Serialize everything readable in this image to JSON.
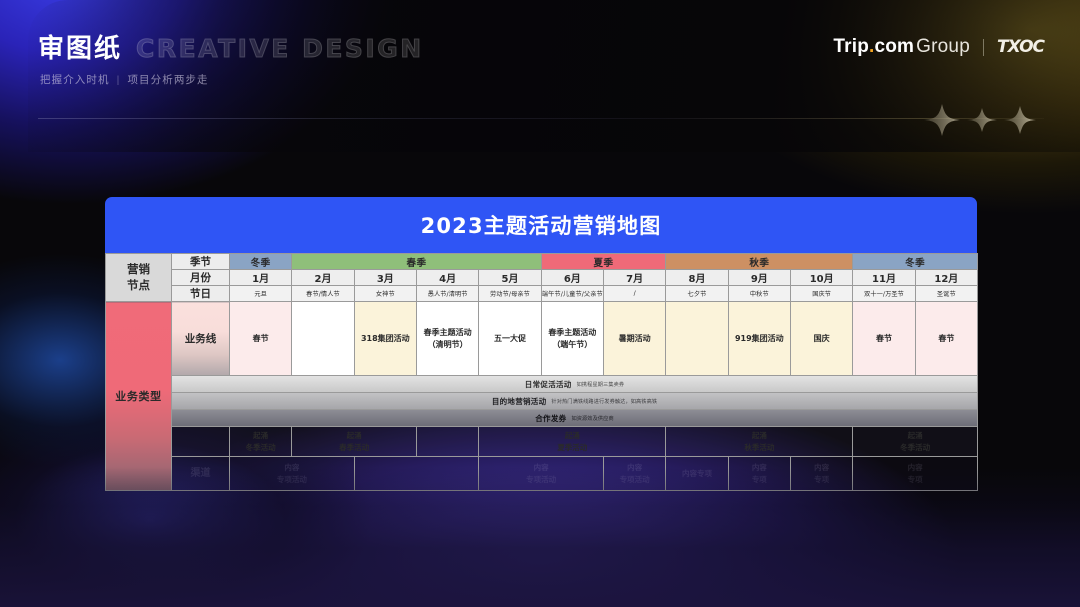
{
  "header": {
    "title_cn": "审图纸",
    "title_en": "CREATIVE DESIGN",
    "subtitle_left": "把握介入时机",
    "subtitle_sep": "|",
    "subtitle_right": "项目分析两步走",
    "brand_trip": "Trip",
    "brand_dot": ".",
    "brand_com": "com",
    "brand_group": "Group",
    "brand_divider": "|",
    "brand_txoc": "TXOC"
  },
  "card": {
    "title": "2023主题活动营销地图",
    "accent_blue": "#2f55f5"
  },
  "table": {
    "node_label": "营销\n节点",
    "node_label_line1": "营销",
    "node_label_line2": "节点",
    "row_labels": {
      "season": "季节",
      "month": "月份",
      "holiday": "节日"
    },
    "biz_type_label": "业务类型",
    "biz_line_label": "业务线",
    "seasons": [
      {
        "name": "冬季",
        "span": 1,
        "color": "#8aa4c4"
      },
      {
        "name": "春季",
        "span": 4,
        "color": "#8fbf7a"
      },
      {
        "name": "夏季",
        "span": 2,
        "color": "#ef6a78"
      },
      {
        "name": "秋季",
        "span": 3,
        "color": "#cd9063"
      },
      {
        "name": "冬季",
        "span": 2,
        "color": "#8aa4c4"
      }
    ],
    "months": [
      "1月",
      "2月",
      "3月",
      "4月",
      "5月",
      "6月",
      "7月",
      "8月",
      "9月",
      "10月",
      "11月",
      "12月"
    ],
    "holidays": [
      "元旦",
      "春节/情人节",
      "女神节",
      "愚人节/清明节",
      "劳动节/母亲节",
      "端午节/儿童节/父亲节",
      "/",
      "七夕节",
      "中秋节",
      "国庆节",
      "双十一/万圣节",
      "圣诞节"
    ],
    "activities": [
      {
        "text": "春节",
        "tone": "pink"
      },
      {
        "text": "",
        "tone": "white"
      },
      {
        "text": "318集团活动",
        "tone": "cream"
      },
      {
        "text": "春季主题活动\n（清明节）",
        "tone": "white"
      },
      {
        "text": "五一大促",
        "tone": "white"
      },
      {
        "text": "春季主题活动\n（端午节）",
        "tone": "white"
      },
      {
        "text": "暑期活动",
        "tone": "cream"
      },
      {
        "text": "",
        "tone": "cream"
      },
      {
        "text": "919集团活动",
        "tone": "cream"
      },
      {
        "text": "国庆",
        "tone": "cream"
      },
      {
        "text": "春节",
        "tone": "pink"
      },
      {
        "text": "春节",
        "tone": "pink"
      }
    ],
    "bands": [
      {
        "main": "日常促活活动",
        "sub": "如携程星期三集卖券"
      },
      {
        "main": "目的地营销活动",
        "sub": "针对热门满铁线路进行发券触达，如高铁高铁"
      },
      {
        "main": "合作发券",
        "sub": "如资源效及供应商"
      }
    ],
    "faded_rows": [
      {
        "cells": [
          {
            "text": "起涌\n冬季活动",
            "span": 1
          },
          {
            "text": "起涌\n春季活动",
            "span": 2
          },
          {
            "text": "",
            "span": 1
          },
          {
            "text": "起涌\n夏季活动",
            "span": 3
          },
          {
            "text": "起涌\n秋季活动",
            "span": 3
          },
          {
            "text": "起涌\n冬季活动",
            "span": 2
          }
        ]
      },
      {
        "label": "渠道",
        "cells": [
          {
            "text": "内容\n专项活动",
            "span": 2
          },
          {
            "text": "",
            "span": 2
          },
          {
            "text": "内容\n专项活动",
            "span": 2
          },
          {
            "text": "内容\n专项活动",
            "span": 1
          },
          {
            "text": "内容专项",
            "span": 1
          },
          {
            "text": "内容\n专项",
            "span": 1
          },
          {
            "text": "内容\n专项",
            "span": 1
          },
          {
            "text": "内容\n专项",
            "span": 2
          }
        ]
      }
    ]
  }
}
